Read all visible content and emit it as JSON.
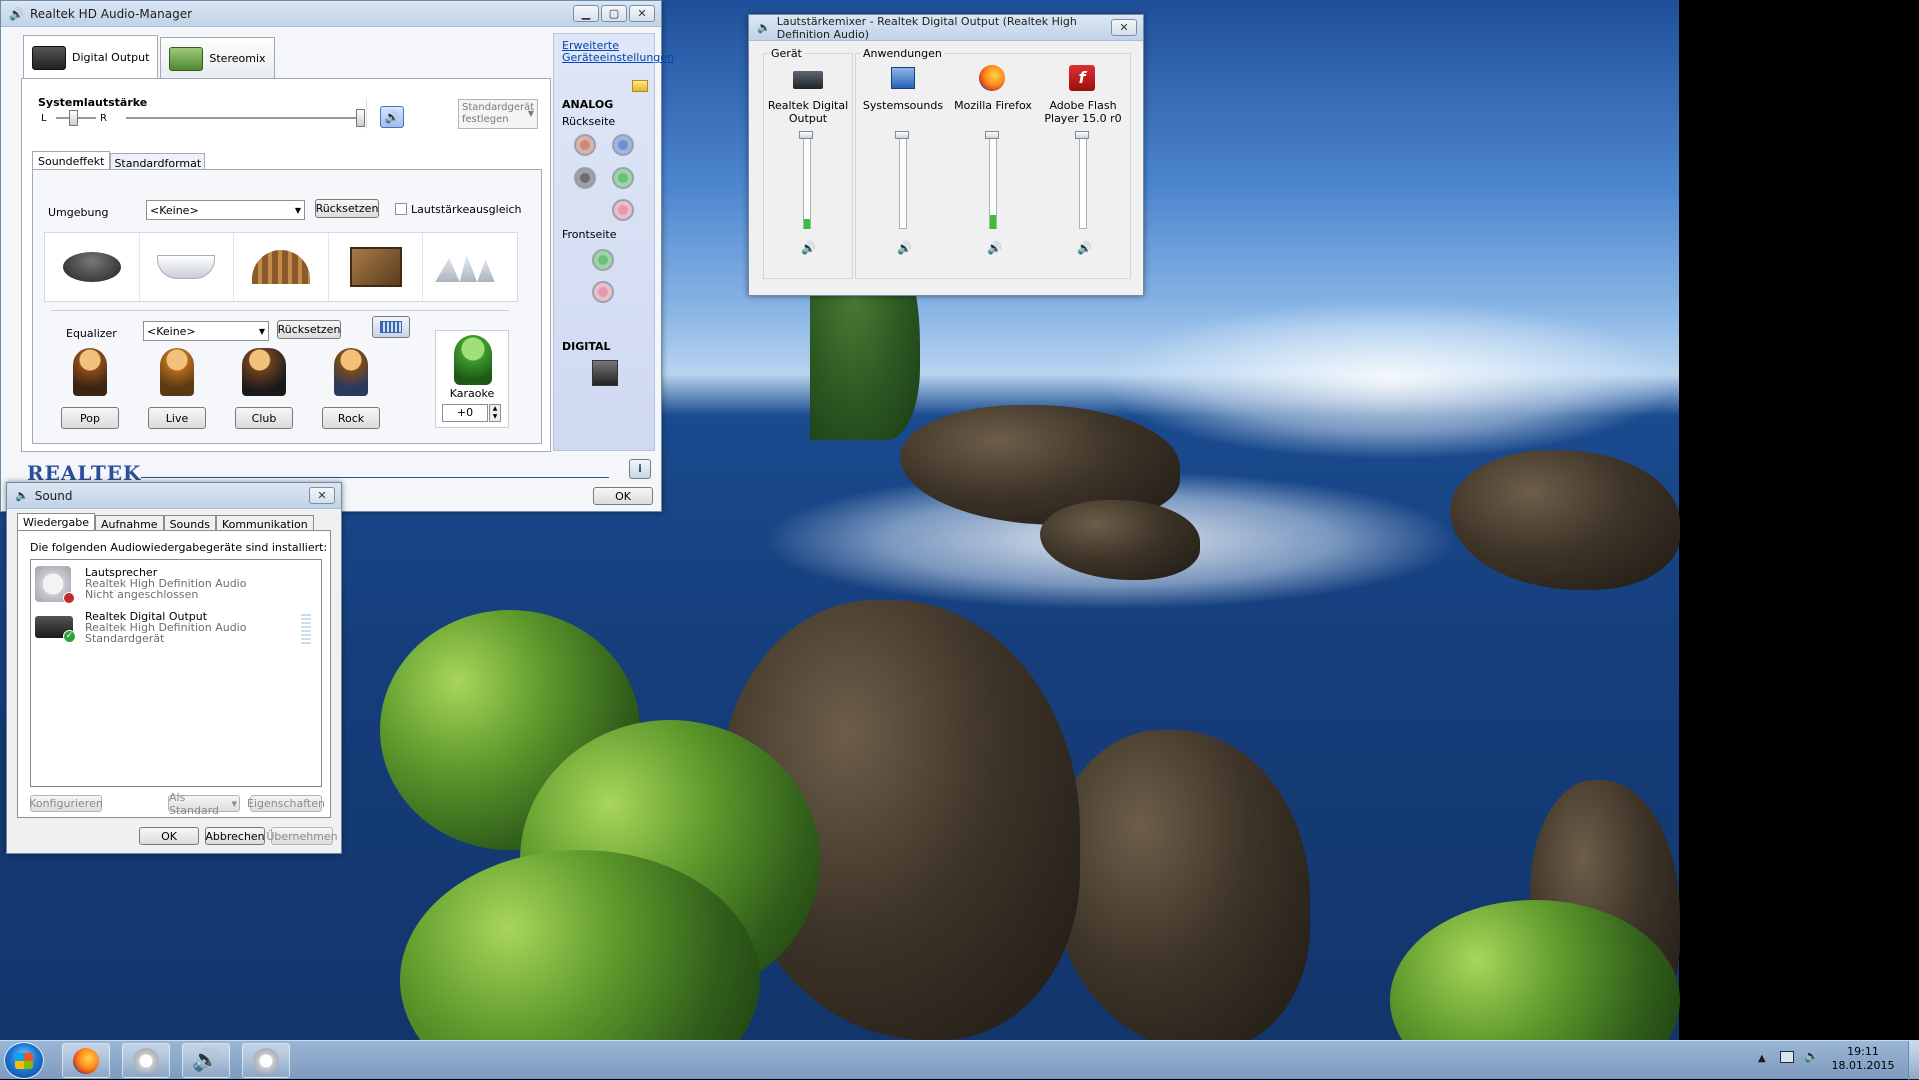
{
  "realtek": {
    "title": "Realtek HD Audio-Manager",
    "device_tabs": [
      "Digital Output",
      "Stereomix"
    ],
    "system_volume_label": "Systemlautstärke",
    "balance_left": "L",
    "balance_right": "R",
    "default_device_button": "Standardgerät festlegen",
    "inner_tabs": [
      "Soundeffekt",
      "Standardformat"
    ],
    "environment_label": "Umgebung",
    "environment_value": "<Keine>",
    "reset_label": "Rücksetzen",
    "loudness_label": "Lautstärkeausgleich",
    "equalizer_label": "Equalizer",
    "equalizer_value": "<Keine>",
    "presets": [
      "Pop",
      "Live",
      "Club",
      "Rock"
    ],
    "karaoke_label": "Karaoke",
    "karaoke_value": "+0",
    "advanced_link": "Erweiterte Geräteeinstellungen",
    "analog_label": "ANALOG",
    "back_label": "Rückseite",
    "front_label": "Frontseite",
    "digital_label": "DIGITAL",
    "brand": "REALTEK",
    "ok_label": "OK"
  },
  "sound": {
    "title": "Sound",
    "tabs": [
      "Wiedergabe",
      "Aufnahme",
      "Sounds",
      "Kommunikation"
    ],
    "intro": "Die folgenden Audiowiedergabegeräte sind installiert:",
    "devices": [
      {
        "name": "Lautsprecher",
        "driver": "Realtek High Definition Audio",
        "status": "Nicht angeschlossen"
      },
      {
        "name": "Realtek Digital Output",
        "driver": "Realtek High Definition Audio",
        "status": "Standardgerät"
      }
    ],
    "configure": "Konfigurieren",
    "set_default": "Als Standard",
    "properties": "Eigenschaften",
    "ok": "OK",
    "cancel": "Abbrechen",
    "apply": "Übernehmen"
  },
  "mixer": {
    "title": "Lautstärkemixer - Realtek Digital Output (Realtek High Definition Audio)",
    "device_group": "Gerät",
    "apps_group": "Anwendungen",
    "channels": [
      {
        "name": "Realtek Digital Output",
        "icon": "digital-output-icon"
      },
      {
        "name": "Systemsounds",
        "icon": "system-sounds-icon"
      },
      {
        "name": "Mozilla Firefox",
        "icon": "firefox-icon"
      },
      {
        "name": "Adobe Flash Player 15.0 r0",
        "icon": "flash-icon"
      }
    ]
  },
  "taskbar": {
    "time": "19:11",
    "date": "18.01.2015"
  }
}
